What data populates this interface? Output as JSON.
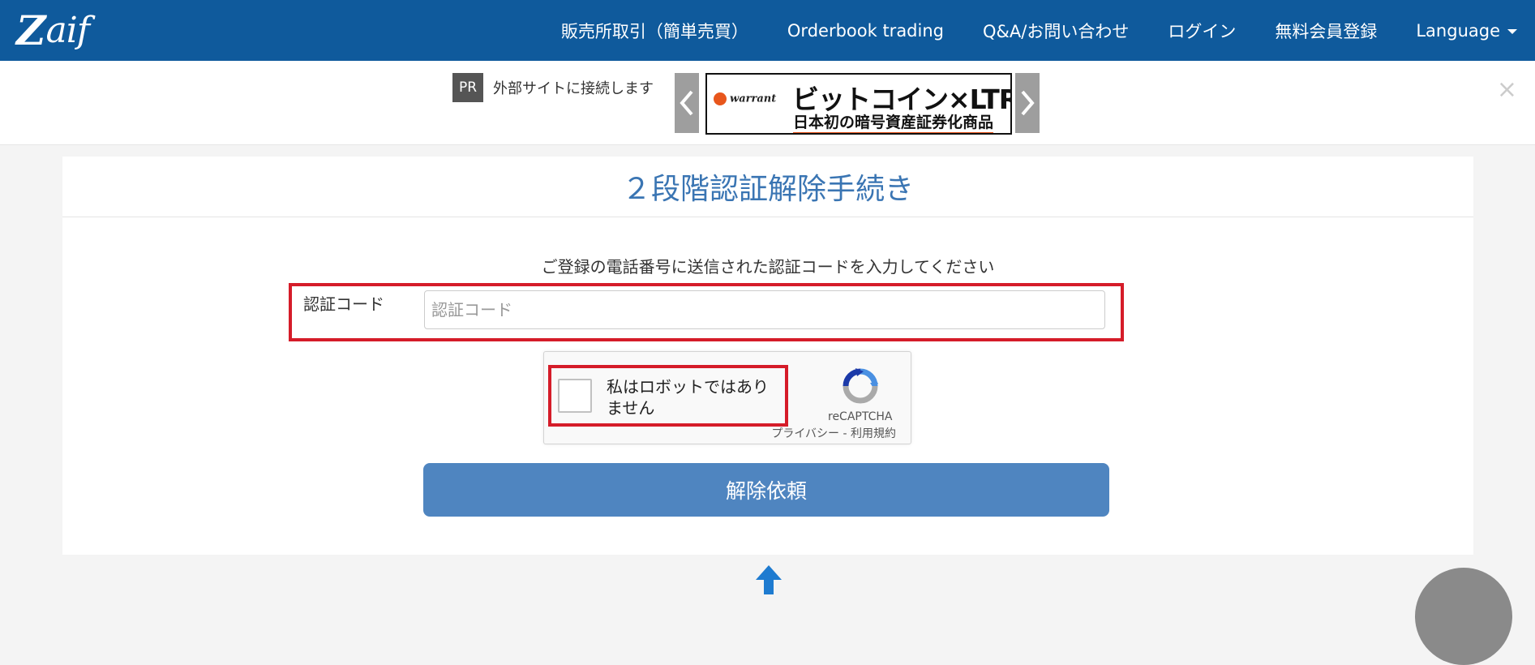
{
  "brand": {
    "logo_text": "aif",
    "logo_mark": "Z"
  },
  "nav": {
    "items": [
      {
        "label": "販売所取引（簡単売買）"
      },
      {
        "label": "Orderbook trading"
      },
      {
        "label": "Q&A/お問い合わせ"
      },
      {
        "label": "ログイン"
      },
      {
        "label": "無料会員登録"
      },
      {
        "label": "Language"
      }
    ]
  },
  "ad": {
    "badge": "PR",
    "notice": "外部サイトに接続します",
    "banner_brand": "warrant",
    "banner_line1": "ビットコイン×LTR",
    "banner_line2": "日本初の暗号資産証券化商品",
    "close_symbol": "×"
  },
  "page": {
    "title": "２段階認証解除手続き",
    "instruction": "ご登録の電話番号に送信された認証コードを入力してください"
  },
  "form": {
    "code_label": "認証コード",
    "code_value": "",
    "code_placeholder": "認証コード",
    "submit_label": "解除依頼"
  },
  "captcha": {
    "label": "私はロボットではありません",
    "brand": "reCAPTCHA",
    "links": "プライバシー - 利用規約",
    "checked": false
  },
  "colors": {
    "navbar": "#0f5a9c",
    "title": "#3a75b3",
    "highlight": "#d51c29",
    "button": "#4f85c0",
    "scroll_arrow": "#1e7bd0"
  }
}
